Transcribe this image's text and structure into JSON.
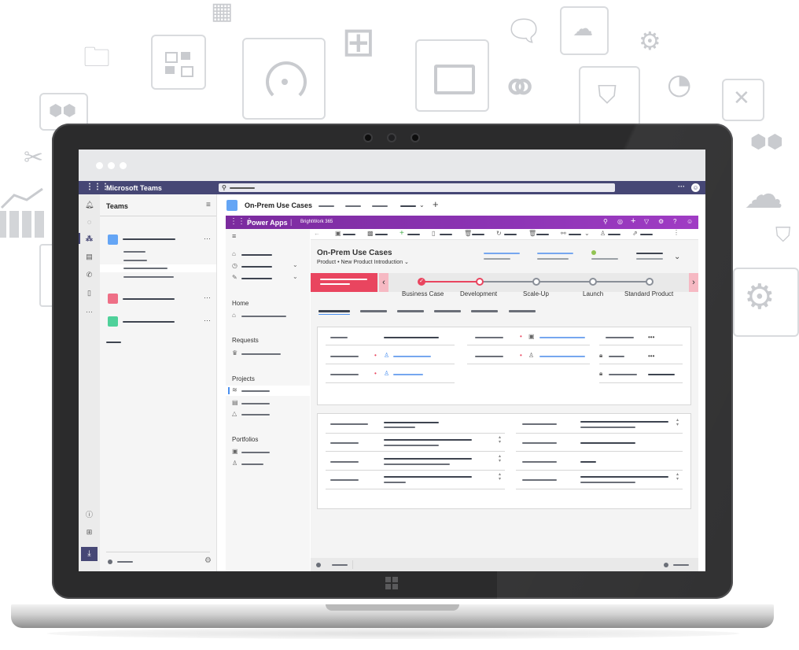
{
  "teams": {
    "app_title": "Microsoft Teams",
    "panel_title": "Teams",
    "channel_title": "On-Prem Use Cases"
  },
  "powerapps": {
    "app_name": "Power Apps",
    "env_name": "BrightWork 365",
    "record_title": "On-Prem Use Cases",
    "record_type": "Product",
    "record_form": "New Product Introduction",
    "nav": {
      "home": "Home",
      "requests": "Requests",
      "projects": "Projects",
      "portfolios": "Portfolios"
    },
    "stages": [
      {
        "label": "Business Case",
        "status": "completed"
      },
      {
        "label": "Development",
        "status": "active"
      },
      {
        "label": "Scale-Up",
        "status": "pending"
      },
      {
        "label": "Launch",
        "status": "pending"
      },
      {
        "label": "Standard Product",
        "status": "pending"
      }
    ]
  },
  "colors": {
    "teams_purple": "#464775",
    "powerapps_purple": "#8d34b5",
    "active_stage": "#e9455f",
    "link_blue": "#76a7ef",
    "status_green": "#92c353"
  },
  "icons": [
    "grid-icon",
    "search-icon",
    "more-icon",
    "avatar-icon",
    "bell-icon",
    "chat-icon",
    "teams-icon",
    "calendar-icon",
    "calls-icon",
    "files-icon",
    "help-icon",
    "apps-icon",
    "download-icon",
    "filter-icon",
    "plus-icon",
    "gear-icon",
    "lock-icon",
    "person-icon",
    "chevron-down-icon",
    "chevron-left-icon",
    "chevron-right-icon"
  ]
}
